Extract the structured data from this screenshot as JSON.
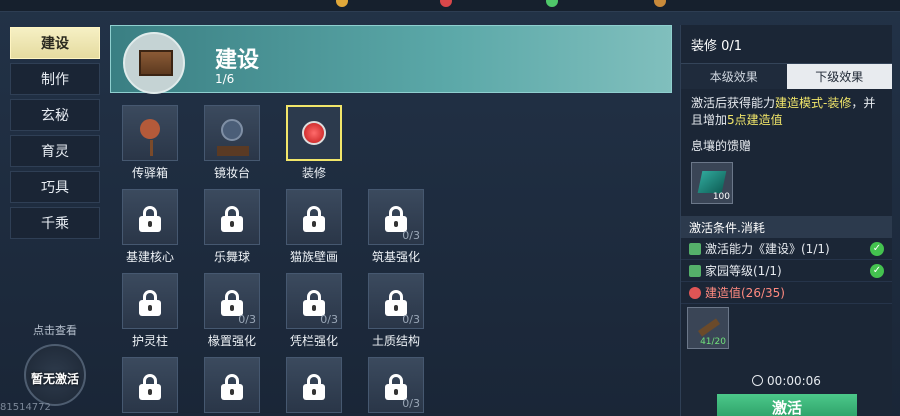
{
  "nav": {
    "items": [
      {
        "label": "建设",
        "active": true
      },
      {
        "label": "制作",
        "active": false
      },
      {
        "label": "玄秘",
        "active": false
      },
      {
        "label": "育灵",
        "active": false
      },
      {
        "label": "巧具",
        "active": false
      },
      {
        "label": "千乘",
        "active": false
      }
    ]
  },
  "inactive_panel": {
    "hint": "点击查看",
    "status": "暂无激活"
  },
  "uid": "81514772",
  "banner": {
    "title": "建设",
    "count": "1/6"
  },
  "grid": {
    "items": [
      {
        "label": "传驿箱",
        "locked": false,
        "selected": false,
        "progress": ""
      },
      {
        "label": "镜妆台",
        "locked": false,
        "selected": false,
        "progress": ""
      },
      {
        "label": "装修",
        "locked": false,
        "selected": true,
        "progress": ""
      },
      {
        "label": "基建核心",
        "locked": true,
        "selected": false,
        "progress": ""
      },
      {
        "label": "乐舞球",
        "locked": true,
        "selected": false,
        "progress": ""
      },
      {
        "label": "猫族壁画",
        "locked": true,
        "selected": false,
        "progress": ""
      },
      {
        "label": "筑基强化",
        "locked": true,
        "selected": false,
        "progress": "0/3"
      },
      {
        "label": "护灵柱",
        "locked": true,
        "selected": false,
        "progress": ""
      },
      {
        "label": "椽置强化",
        "locked": true,
        "selected": false,
        "progress": "0/3"
      },
      {
        "label": "凭栏强化",
        "locked": true,
        "selected": false,
        "progress": "0/3"
      },
      {
        "label": "土质结构",
        "locked": true,
        "selected": false,
        "progress": "0/3"
      },
      {
        "label": "",
        "locked": true,
        "selected": false,
        "progress": ""
      },
      {
        "label": "",
        "locked": true,
        "selected": false,
        "progress": ""
      },
      {
        "label": "",
        "locked": true,
        "selected": false,
        "progress": ""
      },
      {
        "label": "",
        "locked": true,
        "selected": false,
        "progress": "0/3"
      }
    ]
  },
  "detail": {
    "title": "装修 0/1",
    "tabs": [
      {
        "label": "本级效果",
        "active": false
      },
      {
        "label": "下级效果",
        "active": true
      }
    ],
    "desc_pre": "激活后获得能力",
    "desc_link": "建造模式-装修",
    "desc_mid": "，并且增加",
    "desc_value": "5点建造值",
    "gift_label": "息壤的馈赠",
    "gift_qty": "100",
    "cond_title": "激活条件.消耗",
    "conditions": [
      {
        "text": "激活能力《建设》(1/1)",
        "met": true
      },
      {
        "text": "家园等级(1/1)",
        "met": true
      },
      {
        "text": "建造值(26/35)",
        "met": false
      }
    ],
    "material_qty": "41/20",
    "timer": "00:00:06",
    "activate_label": "激活"
  },
  "colors": {
    "accent": "#f2e66a",
    "success": "#44c24f",
    "fail": "#ff8a80"
  }
}
